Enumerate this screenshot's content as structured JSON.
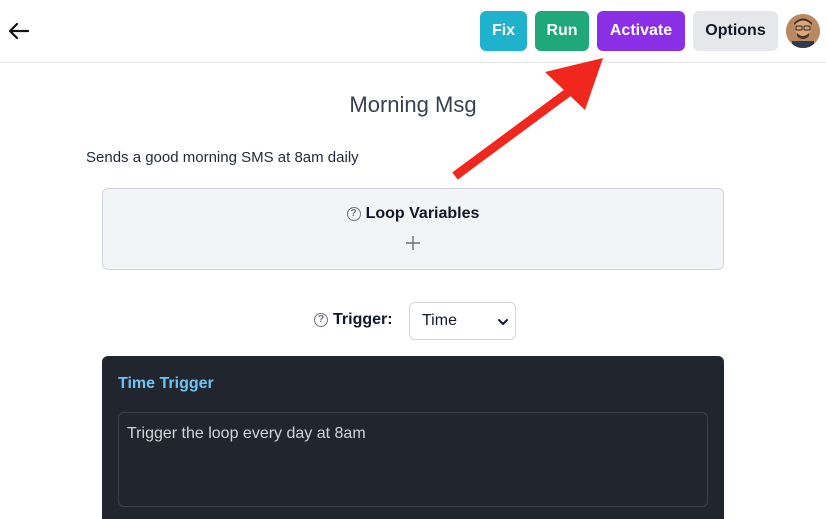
{
  "header": {
    "back_icon": "arrow-left-icon",
    "buttons": {
      "fix": "Fix",
      "run": "Run",
      "activate": "Activate",
      "options": "Options"
    },
    "avatar_icon": "user-avatar"
  },
  "page": {
    "title": "Morning Msg",
    "description": "Sends a good morning SMS at 8am daily"
  },
  "loop_variables": {
    "label": "Loop Variables",
    "help_icon": "question-circle-icon",
    "add_icon": "plus-icon"
  },
  "trigger": {
    "label": "Trigger:",
    "selected": "Time",
    "help_icon": "question-circle-icon"
  },
  "time_trigger": {
    "title": "Time Trigger",
    "value": "Trigger the loop every day at 8am"
  },
  "colors": {
    "fix": "#1eb2cd",
    "run": "#1fa97a",
    "activate": "#8b2fe6",
    "options": "#e5e7eb",
    "panel_bg": "#21252d",
    "panel_title": "#6fc3f5",
    "annotation_arrow": "#f0271d"
  }
}
